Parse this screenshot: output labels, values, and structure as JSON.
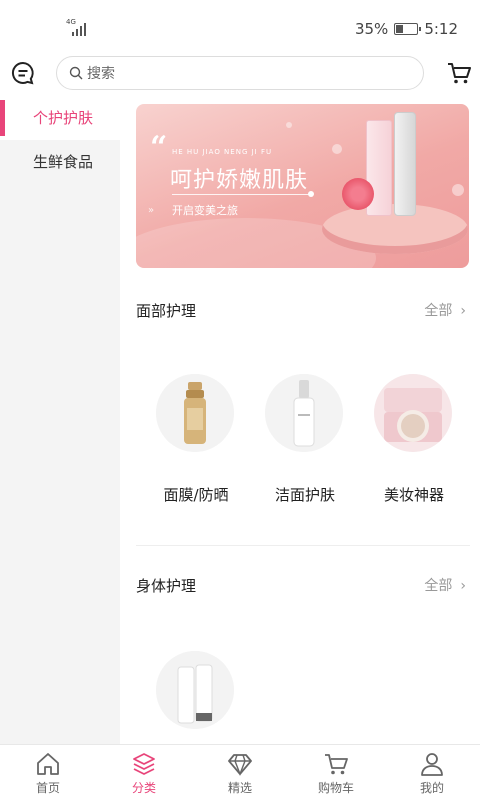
{
  "status": {
    "network": "4G",
    "battery": "35%",
    "battery_level": 0.35,
    "time": "5:12"
  },
  "header": {
    "search_placeholder": "搜索",
    "icons": {
      "message": "message-icon",
      "search": "search-icon",
      "cart": "cart-icon"
    }
  },
  "sidebar": {
    "items": [
      {
        "label": "个护护肤",
        "active": true
      },
      {
        "label": "生鲜食品",
        "active": false
      }
    ]
  },
  "banner": {
    "pinyin": "HE HU JIAO NENG JI FU",
    "title": "呵护娇嫩肌肤",
    "subtitle": "开启变美之旅"
  },
  "sections": [
    {
      "title": "面部护理",
      "more": "全部",
      "categories": [
        {
          "label": "面膜/防晒",
          "image": "gold-spray-bottle"
        },
        {
          "label": "洁面护肤",
          "image": "white-serum-bottle"
        },
        {
          "label": "美妆神器",
          "image": "cushion-compact"
        }
      ]
    },
    {
      "title": "身体护理",
      "more": "全部",
      "categories": [
        {
          "label": "",
          "image": "white-lotion-tube"
        }
      ]
    }
  ],
  "tabbar": {
    "items": [
      {
        "label": "首页",
        "icon": "home-icon",
        "active": false
      },
      {
        "label": "分类",
        "icon": "layers-icon",
        "active": true
      },
      {
        "label": "精选",
        "icon": "diamond-icon",
        "active": false
      },
      {
        "label": "购物车",
        "icon": "cart-icon",
        "active": false
      },
      {
        "label": "我的",
        "icon": "user-icon",
        "active": false
      }
    ]
  },
  "colors": {
    "accent": "#e8457a",
    "sidebar_bg": "#f4f4f4",
    "banner_pink": "#f1a9a6"
  }
}
